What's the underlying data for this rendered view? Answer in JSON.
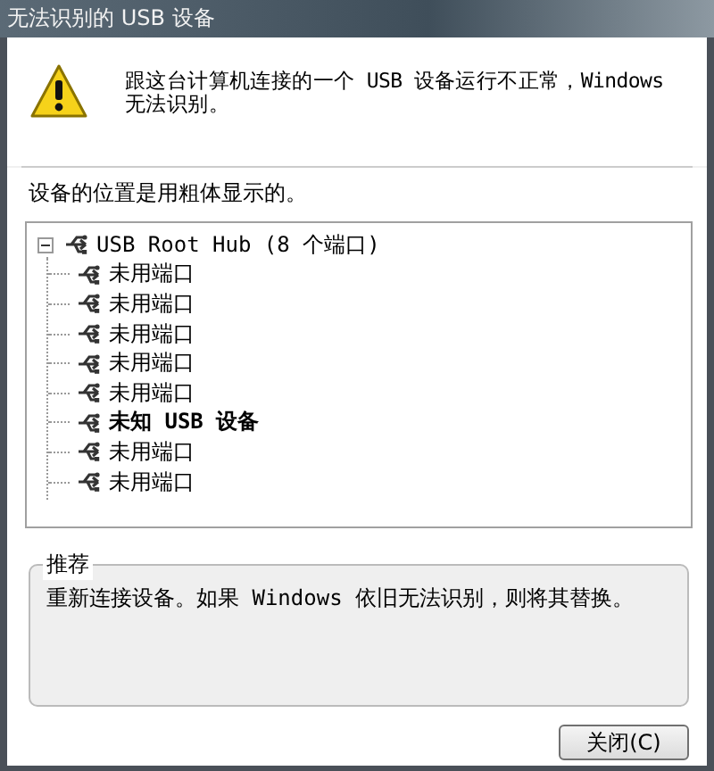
{
  "window": {
    "title": "无法识别的 USB 设备"
  },
  "message": "跟这台计算机连接的一个 USB 设备运行不正常，Windows 无法识别。",
  "location_note": "设备的位置是用粗体显示的。",
  "tree": {
    "label": "USB Root Hub (8 个端口)",
    "expanded": true,
    "bold": false,
    "children": [
      {
        "label": "未用端口",
        "bold": false
      },
      {
        "label": "未用端口",
        "bold": false
      },
      {
        "label": "未用端口",
        "bold": false
      },
      {
        "label": "未用端口",
        "bold": false
      },
      {
        "label": "未用端口",
        "bold": false
      },
      {
        "label": "未知 USB 设备",
        "bold": true
      },
      {
        "label": "未用端口",
        "bold": false
      },
      {
        "label": "未用端口",
        "bold": false
      }
    ]
  },
  "recommendation": {
    "title": "推荐",
    "text": "重新连接设备。如果 Windows 依旧无法识别，则将其替换。"
  },
  "buttons": [
    {
      "label": "关闭(C)"
    }
  ]
}
